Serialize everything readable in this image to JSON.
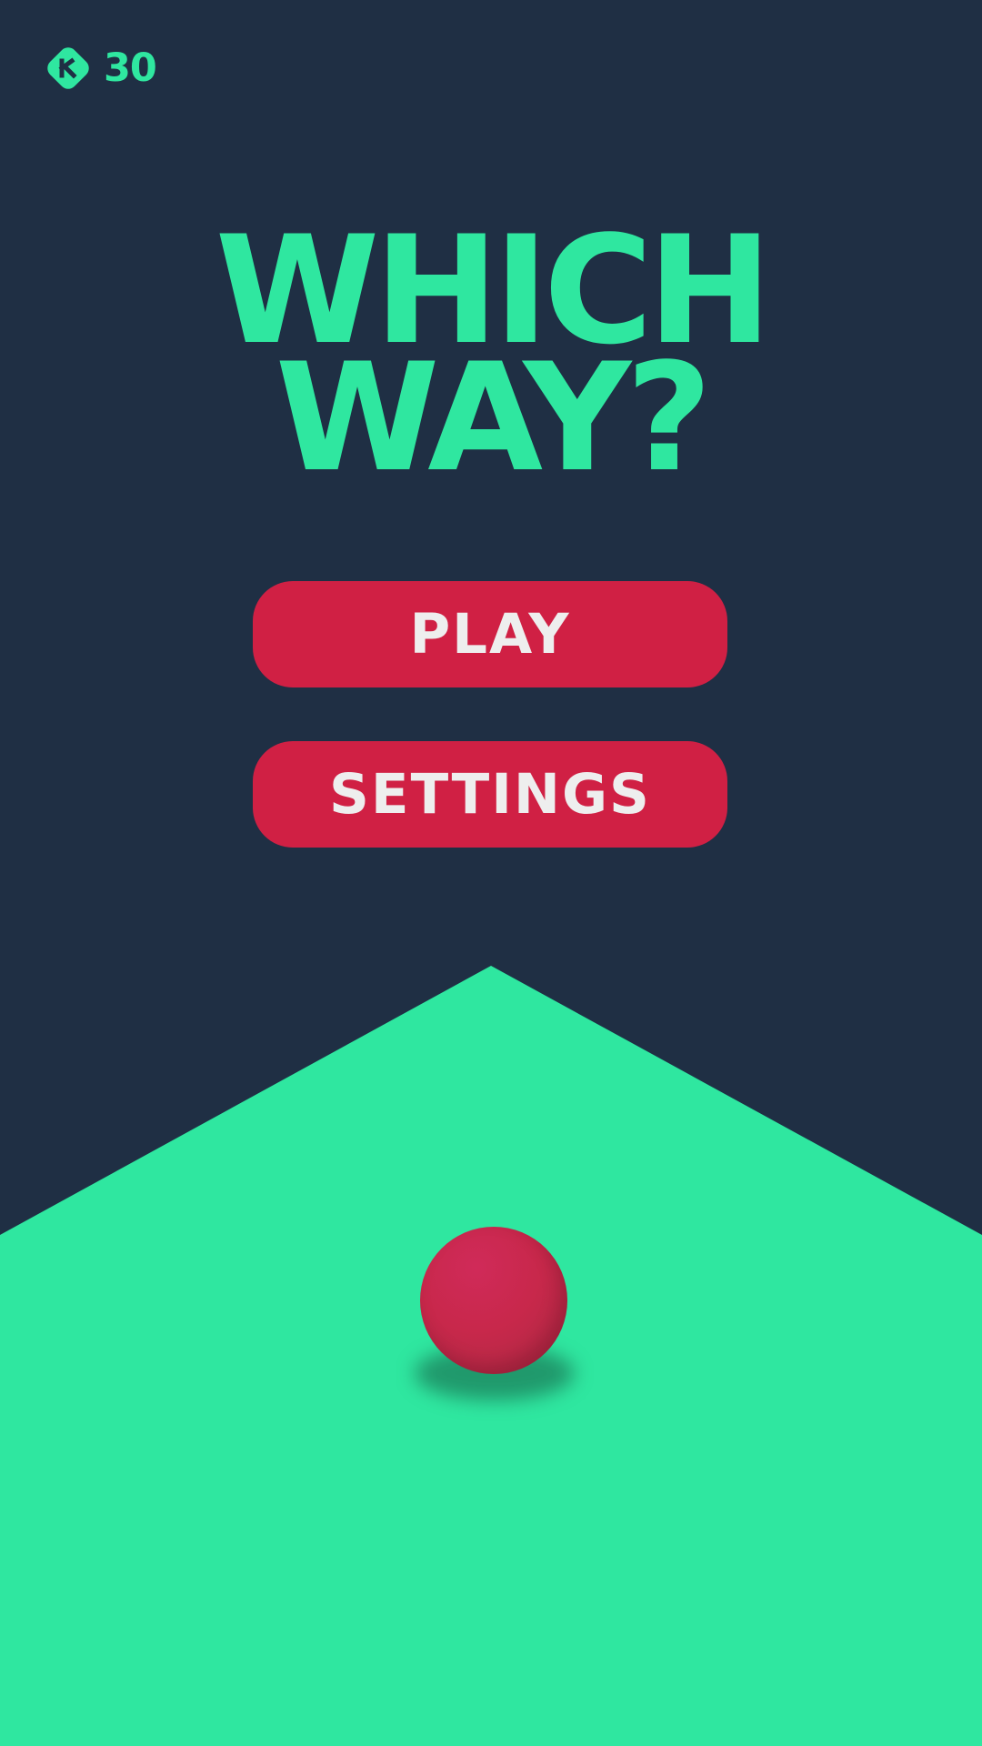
{
  "hud": {
    "coin_icon": "coin-icon",
    "coin_count": "30"
  },
  "title": {
    "line1": "WHICH",
    "line2": "WAY?"
  },
  "menu": {
    "play_label": "PLAY",
    "settings_label": "SETTINGS"
  },
  "colors": {
    "background": "#1f2f44",
    "accent": "#2fe7a0",
    "button": "#d02044",
    "button_text": "#eeeeee",
    "ball": "#c8284b"
  }
}
